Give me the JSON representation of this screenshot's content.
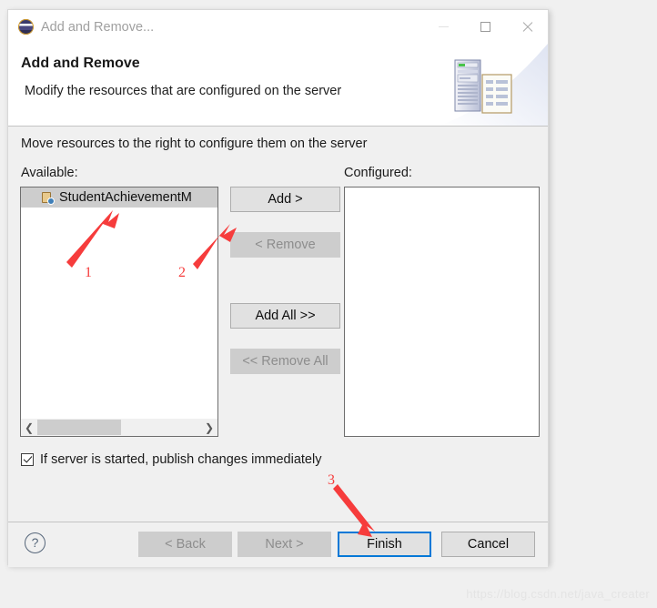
{
  "window": {
    "title": "Add and Remove...",
    "icon": "eclipse-icon",
    "controls": {
      "minimize": "minimize-icon",
      "maximize": "maximize-icon",
      "close": "close-icon"
    }
  },
  "header": {
    "title": "Add and Remove",
    "description": "Modify the resources that are configured on the server",
    "art": "server-and-document-icon"
  },
  "body": {
    "instruction": "Move resources to the right to configure them on the server",
    "available": {
      "label": "Available:",
      "items": [
        {
          "name": "StudentAchievementM",
          "icon": "web-project-icon",
          "selected": true
        }
      ]
    },
    "configured": {
      "label": "Configured:",
      "items": []
    },
    "transfer_buttons": [
      {
        "label": "Add >",
        "enabled": true
      },
      {
        "label": "< Remove",
        "enabled": false
      },
      {
        "label": "Add All >>",
        "enabled": true
      },
      {
        "label": "<< Remove All",
        "enabled": false
      }
    ],
    "publish_checkbox": {
      "label": "If server is started, publish changes immediately",
      "checked": true
    },
    "scrollbar": {
      "left_arrow": "chevron-left-icon",
      "right_arrow": "chevron-right-icon"
    }
  },
  "footer": {
    "help": "?",
    "buttons": [
      {
        "label": "< Back",
        "enabled": false,
        "focused": false
      },
      {
        "label": "Next >",
        "enabled": false,
        "focused": false
      },
      {
        "label": "Finish",
        "enabled": true,
        "focused": true
      },
      {
        "label": "Cancel",
        "enabled": true,
        "focused": false
      }
    ]
  },
  "annotations": {
    "accent_color": "#f63c3c",
    "markers": [
      {
        "number": "1",
        "target": "available-list"
      },
      {
        "number": "2",
        "target": "add-button"
      },
      {
        "number": "3",
        "target": "finish-button"
      }
    ]
  },
  "watermark": "https://blog.csdn.net/java_creater"
}
